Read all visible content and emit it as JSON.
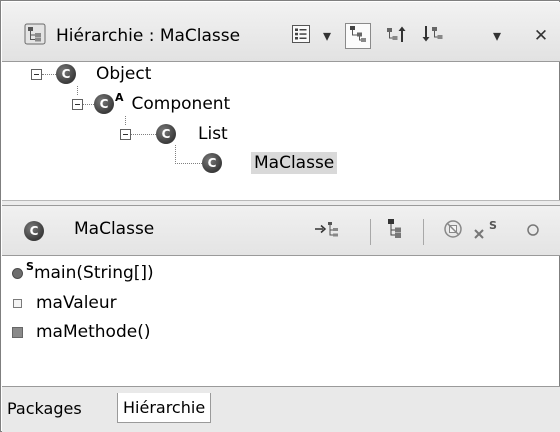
{
  "hierarchy_view": {
    "title": "Hiérarchie : MaClasse",
    "toolbar": [
      {
        "icon": "history-icon"
      },
      {
        "icon": "dropdown-arrow-icon",
        "glyph": "▾"
      },
      {
        "icon": "type-hierarchy-icon"
      },
      {
        "icon": "supertype-hierarchy-icon"
      },
      {
        "icon": "subtype-hierarchy-icon"
      },
      {
        "icon": "view-menu-icon",
        "glyph": "▾"
      },
      {
        "icon": "close-icon",
        "glyph": "✕"
      }
    ],
    "tree": [
      {
        "label": "Object",
        "icon_letter": "C"
      },
      {
        "label": "Component",
        "icon_letter": "C",
        "badge": "A"
      },
      {
        "label": "List",
        "icon_letter": "C"
      },
      {
        "label": "MaClasse",
        "icon_letter": "C",
        "selected": true
      }
    ]
  },
  "members_view": {
    "class_name": "MaClasse",
    "class_icon_letter": "C",
    "toolbar_static_badge": "S",
    "members": [
      {
        "label": "main(String[])",
        "kind": "static-method",
        "badge": "S"
      },
      {
        "label": "maValeur",
        "kind": "field"
      },
      {
        "label": "maMethode()",
        "kind": "method"
      }
    ]
  },
  "tabs": [
    {
      "label": "Packages",
      "active": false
    },
    {
      "label": "Hiérarchie",
      "active": true
    }
  ]
}
